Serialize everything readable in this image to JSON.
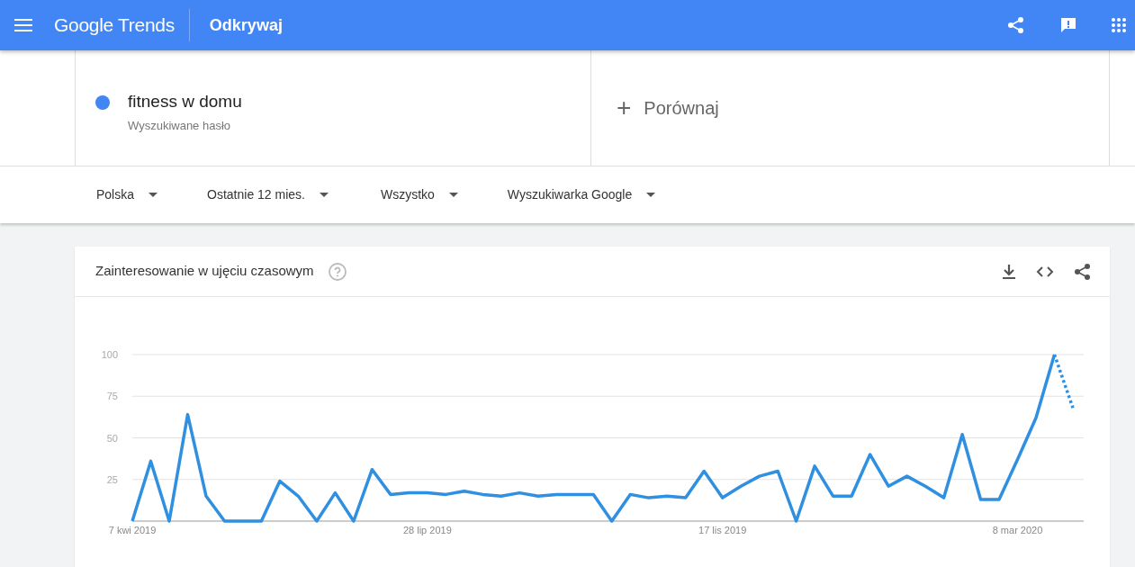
{
  "header": {
    "logo": "Google Trends",
    "section": "Odkrywaj"
  },
  "terms": [
    {
      "label": "fitness w domu",
      "sublabel": "Wyszukiwane hasło",
      "color": "#4285f4"
    }
  ],
  "compare": {
    "label": "Porównaj",
    "icon": "+"
  },
  "filters": [
    {
      "label": "Polska"
    },
    {
      "label": "Ostatnie 12 mies."
    },
    {
      "label": "Wszystko"
    },
    {
      "label": "Wyszukiwarka Google"
    }
  ],
  "interest_card": {
    "title": "Zainteresowanie w ujęciu czasowym",
    "chart_data": {
      "type": "line",
      "categories": [
        "7 kwi 2019",
        null,
        null,
        null,
        null,
        null,
        null,
        null,
        null,
        null,
        null,
        null,
        null,
        null,
        null,
        null,
        "28 lip 2019",
        null,
        null,
        null,
        null,
        null,
        null,
        null,
        null,
        null,
        null,
        null,
        null,
        null,
        null,
        null,
        "17 lis 2019",
        null,
        null,
        null,
        null,
        null,
        null,
        null,
        null,
        null,
        null,
        null,
        null,
        null,
        null,
        null,
        "8 mar 2020",
        null,
        null,
        null
      ],
      "ylim": [
        0,
        100
      ],
      "yticks": [
        {
          "value": 25,
          "label": "25"
        },
        {
          "value": 50,
          "label": "50"
        },
        {
          "value": 75,
          "label": "75"
        },
        {
          "value": 100,
          "label": "100"
        }
      ],
      "grid": true,
      "series": [
        {
          "color": "#2f8fe0",
          "values": [
            0,
            36,
            0,
            64,
            15,
            0,
            0,
            0,
            24,
            15,
            0,
            17,
            0,
            31,
            16,
            17,
            17,
            16,
            18,
            16,
            15,
            17,
            15,
            16,
            16,
            16,
            0,
            16,
            14,
            15,
            14,
            30,
            14,
            21,
            27,
            30,
            0,
            33,
            15,
            15,
            40,
            21,
            27,
            21,
            14,
            52,
            13,
            13,
            37,
            62,
            100,
            null
          ]
        },
        {
          "color": "#2f8fe0",
          "line_style": "dashed",
          "values": [
            null,
            null,
            null,
            null,
            null,
            null,
            null,
            null,
            null,
            null,
            null,
            null,
            null,
            null,
            null,
            null,
            null,
            null,
            null,
            null,
            null,
            null,
            null,
            null,
            null,
            null,
            null,
            null,
            null,
            null,
            null,
            null,
            null,
            null,
            null,
            null,
            null,
            null,
            null,
            null,
            null,
            null,
            null,
            null,
            null,
            null,
            null,
            null,
            null,
            null,
            100,
            68
          ]
        }
      ]
    }
  }
}
